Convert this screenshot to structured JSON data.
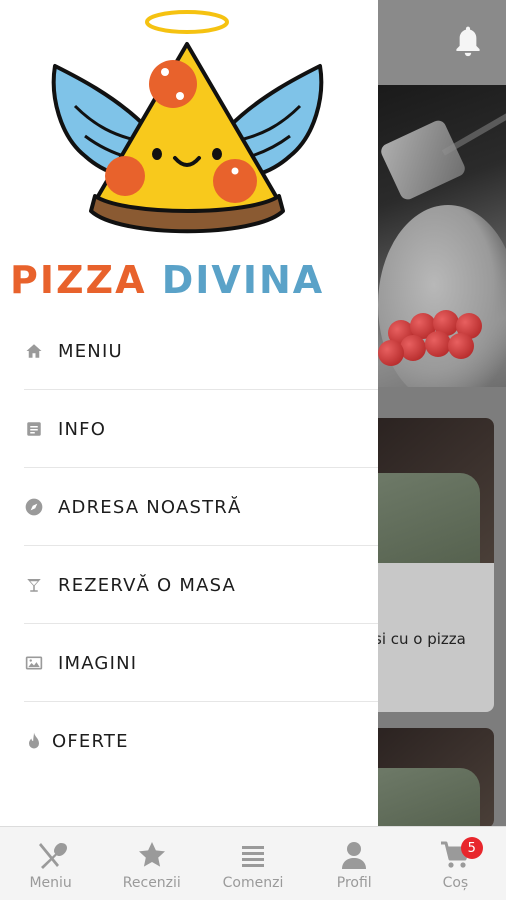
{
  "app": {
    "brand_word1": "PIZZA",
    "brand_word2": "DIVINA",
    "brand_colors": {
      "primary": "#e8622c",
      "secondary": "#5aa2c8"
    }
  },
  "background": {
    "card_text": "si cu o pizza"
  },
  "drawer": {
    "items": [
      {
        "label": "MENIU",
        "icon": "home-icon"
      },
      {
        "label": "INFO",
        "icon": "document-icon"
      },
      {
        "label": "ADRESA NOASTRĂ",
        "icon": "compass-icon"
      },
      {
        "label": "REZERVĂ O MASA",
        "icon": "cocktail-icon"
      },
      {
        "label": "IMAGINI",
        "icon": "image-icon"
      },
      {
        "label": "OFERTE",
        "icon": "flame-icon"
      }
    ]
  },
  "bottom_nav": {
    "items": [
      {
        "label": "Meniu",
        "icon": "fork-knife-icon"
      },
      {
        "label": "Recenzii",
        "icon": "star-icon"
      },
      {
        "label": "Comenzi",
        "icon": "list-icon"
      },
      {
        "label": "Profil",
        "icon": "person-icon"
      },
      {
        "label": "Coș",
        "icon": "cart-icon",
        "badge": "5"
      }
    ],
    "badge_color": "#e8262c"
  }
}
